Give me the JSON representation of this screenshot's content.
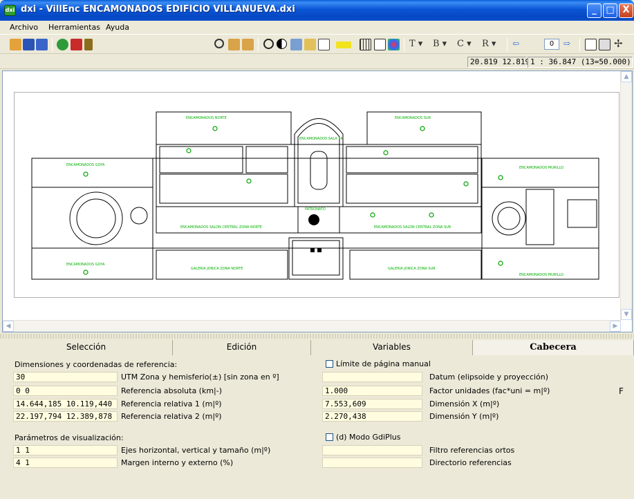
{
  "window": {
    "app_icon_text": "dxi",
    "title": "dxi - VillEnc ENCAMONADOS EDIFICIO VILLANUEVA.dxi",
    "minimize": "_",
    "maximize": "□",
    "close": "X"
  },
  "menu": {
    "archivo": "Archivo",
    "herramientas": "Herramientas",
    "ayuda": "Ayuda"
  },
  "toolbar": {
    "font_t": "T ▾",
    "font_b": "B ▾",
    "font_c": "C ▾",
    "font_r": "R ▾",
    "zoom_value": "0",
    "icons": [
      "open-icon",
      "save-icon",
      "save-as-icon",
      "globe-icon",
      "layers-icon",
      "tools-icon",
      "zoom-icon",
      "copy-icon",
      "paste-icon",
      "face-icon",
      "contrast-icon",
      "check-icon",
      "check2-icon",
      "page-icon",
      "color-icon",
      "grid-icon",
      "list-icon",
      "palette-icon",
      "arrow-left-icon",
      "arrow-right-icon",
      "ruler-icon",
      "print-icon",
      "target-icon"
    ]
  },
  "status": {
    "coords": "20.819 12.819",
    "scale": "1 : 36.847 (13=50.000)"
  },
  "plan": {
    "north_hall": "ENCAMONADOS NORTE",
    "south_hall": "ENCAMONADOS SUR",
    "central_north": "ENCAMONADOS SALON CENTRAL ZONA NORTE",
    "central_south": "ENCAMONADOS SALON CENTRAL ZONA SUR",
    "gallery_north": "GALERIA JONICA ZONA NORTE",
    "gallery_south": "GALERIA JONICA ZONA SUR",
    "west": "ENCAMONADOS GOYA",
    "west_b": "ENCAMONADOS GOYA",
    "east": "ENCAMONADOS MURILLO",
    "east_b": "ENCAMONADOS MURILLO",
    "rotunda": "ENCAMONADOS SALA 14",
    "vestibule": "PATRONATO"
  },
  "tabs": {
    "seleccion": "Selección",
    "edicion": "Edición",
    "variables": "Variables",
    "cabecera": "Cabecera"
  },
  "cabecera": {
    "section1_title": "Dimensiones y coordenadas de referencia:",
    "utm_value": "30",
    "utm_label": "UTM Zona y hemisferio(±) [sin zona en º]",
    "ref_abs_value": "0 0",
    "ref_abs_label": "Referencia absoluta (km|-)",
    "ref_rel1_value": "14.644,185 10.119,440",
    "ref_rel1_label": "Referencia relativa 1 (m|º)",
    "ref_rel2_value": "22.197,794 12.389,878",
    "ref_rel2_label": "Referencia relativa 2 (m|º)",
    "limite_label": "Límite de página manual",
    "datum_value": "",
    "datum_label": "Datum (elipsoide y proyección)",
    "factor_value": "1.000",
    "factor_label": "Factor unidades (fac*uni = m|º)",
    "dim_x_value": "7.553,609",
    "dim_x_label": "Dimensión X (m|º)",
    "dim_y_value": "2.270,438",
    "dim_y_label": "Dimensión Y (m|º)",
    "f_letter": "F",
    "section2_title": "Parámetros de visualización:",
    "ejes_value": "1 1",
    "ejes_label": "Ejes horizontal, vertical y tamaño (m|º)",
    "margen_value": "4 1",
    "margen_label": "Margen interno y externo (%)",
    "gdiplus_label": "(d) Modo GdiPlus",
    "filtro_value": "",
    "filtro_label": "Filtro referencias ortos",
    "directorio_value": "",
    "directorio_label": "Directorio referencias"
  },
  "colors": {
    "title_blue": "#0b56d6",
    "input_fill": "#fffce0",
    "plan_line": "#000000",
    "plan_text": "#00b000"
  }
}
